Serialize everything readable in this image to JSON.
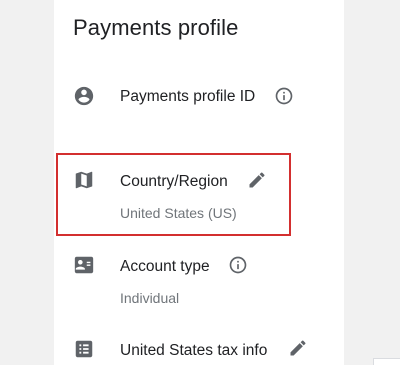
{
  "page": {
    "title": "Payments profile"
  },
  "rows": [
    {
      "icon": "account-circle-icon",
      "label": "Payments profile ID",
      "value": "",
      "action": "info-icon"
    },
    {
      "icon": "map-icon",
      "label": "Country/Region",
      "value": "United States (US)",
      "action": "edit-pencil-icon"
    },
    {
      "icon": "id-card-icon",
      "label": "Account type",
      "value": "Individual",
      "action": "info-icon"
    },
    {
      "icon": "tax-document-icon",
      "label": "United States tax info",
      "value": "",
      "action": "edit-pencil-icon"
    }
  ],
  "colors": {
    "text_primary": "#202124",
    "text_secondary": "#70757a",
    "icon": "#5f6368",
    "highlight": "#d32f2f"
  }
}
